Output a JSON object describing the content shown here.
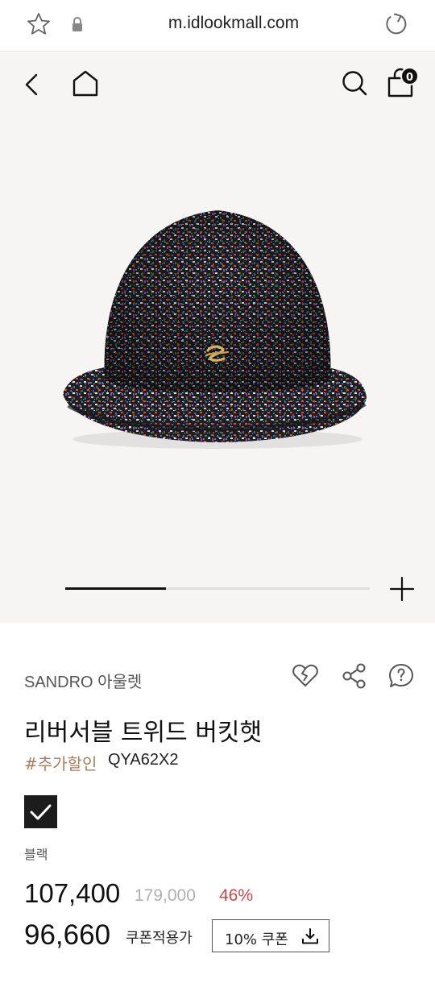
{
  "browser": {
    "url": "m.idlookmall.com",
    "icons": [
      "star-icon",
      "lock-icon",
      "reload-icon"
    ]
  },
  "header": {
    "icons": [
      "back-icon",
      "home-icon",
      "search-icon",
      "shopping-bag-icon"
    ],
    "cart_count": "0"
  },
  "gallery": {
    "progress": 0.33,
    "expand_icon": "plus-icon"
  },
  "product": {
    "brand": "SANDRO 아울렛",
    "action_icons": [
      "heart-icon",
      "share-icon",
      "question-icon"
    ],
    "name": "리버서블 트위드 버킷햇",
    "tag": "#추가할인",
    "code": "QYA62X2",
    "color_option": {
      "name": "블랙",
      "swatch_color": "#1c1c1c",
      "selected": true
    },
    "price": "107,400",
    "original_price": "179,000",
    "discount": "46%",
    "coupon_price": "96,660",
    "coupon_price_label": "쿠폰적용가",
    "coupon_button_label": "10% 쿠폰"
  },
  "colors": {
    "discount_red": "#d64545",
    "tag_brown": "#a97d5d",
    "hero_background": "#f6f5f3"
  }
}
